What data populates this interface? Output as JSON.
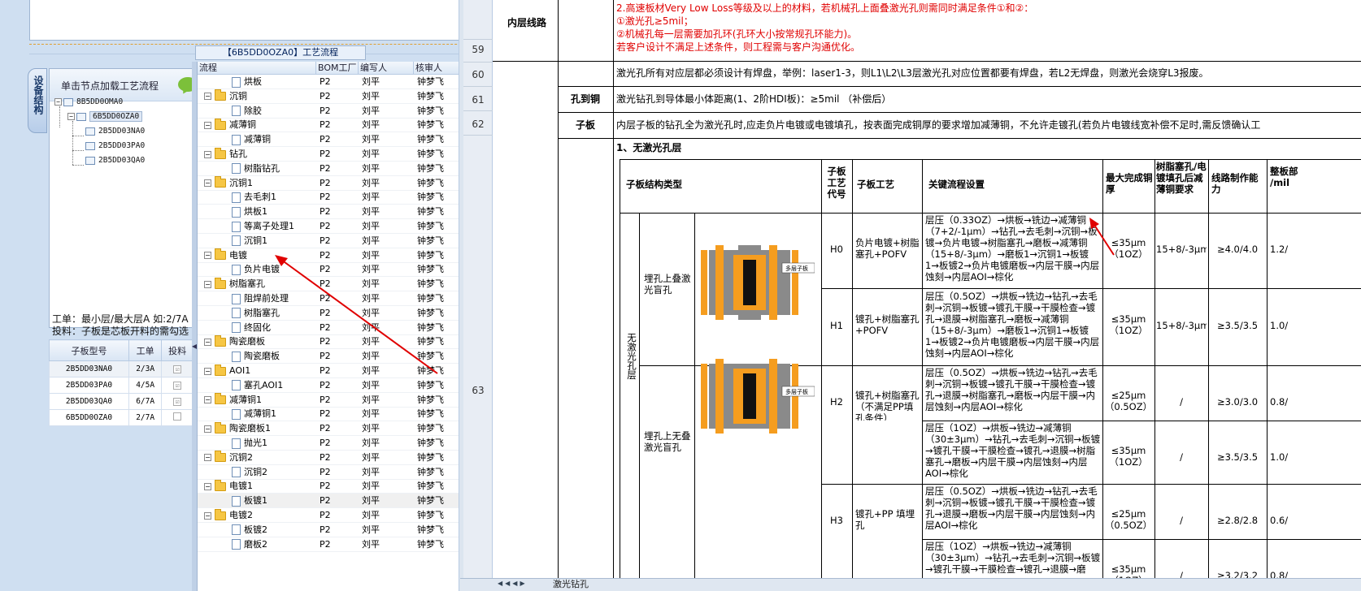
{
  "proc_title": "【6B5DD0OZA0】工艺流程",
  "tree_panel": {
    "header": "单击节点加载工艺流程",
    "side_tab": "设备结构",
    "nodes": [
      {
        "label": "8B5DD0OMA0"
      },
      {
        "label": "6B5DD0OZA0"
      },
      {
        "label": "2B5DD03NA0"
      },
      {
        "label": "2B5DD03PA0"
      },
      {
        "label": "2B5DD03QA0"
      }
    ]
  },
  "info": {
    "line1": "工单：最小层/最大层A 如:2/7A",
    "line2": "投料：子板是芯板开料的需勾选"
  },
  "sub_table": {
    "headers": [
      "子板型号",
      "工单",
      "投料"
    ],
    "rows": [
      {
        "model": "2B5DD03NA0",
        "order": "2/3A",
        "feed": "☑"
      },
      {
        "model": "2B5DD03PA0",
        "order": "4/5A",
        "feed": "☑"
      },
      {
        "model": "2B5DD03QA0",
        "order": "6/7A",
        "feed": "☑"
      },
      {
        "model": "6B5DD0OZA0",
        "order": "2/7A",
        "feed": ""
      }
    ]
  },
  "flow": {
    "headers": [
      "流程",
      "BOM工厂",
      "编写人",
      "核审人"
    ],
    "rows": [
      {
        "name": "烘板",
        "level": 2,
        "factory": "P2",
        "writer": "刘平",
        "checker": "钟梦飞"
      },
      {
        "name": "沉铜",
        "level": 1,
        "factory": "P2",
        "writer": "刘平",
        "checker": "钟梦飞"
      },
      {
        "name": "除胶",
        "level": 2,
        "factory": "P2",
        "writer": "刘平",
        "checker": "钟梦飞"
      },
      {
        "name": "减薄铜",
        "level": 1,
        "factory": "P2",
        "writer": "刘平",
        "checker": "钟梦飞"
      },
      {
        "name": "减薄铜",
        "level": 2,
        "factory": "P2",
        "writer": "刘平",
        "checker": "钟梦飞"
      },
      {
        "name": "钻孔",
        "level": 1,
        "factory": "P2",
        "writer": "刘平",
        "checker": "钟梦飞"
      },
      {
        "name": "树脂钻孔",
        "level": 2,
        "factory": "P2",
        "writer": "刘平",
        "checker": "钟梦飞"
      },
      {
        "name": "沉铜1",
        "level": 1,
        "factory": "P2",
        "writer": "刘平",
        "checker": "钟梦飞"
      },
      {
        "name": "去毛刺1",
        "level": 2,
        "factory": "P2",
        "writer": "刘平",
        "checker": "钟梦飞"
      },
      {
        "name": "烘板1",
        "level": 2,
        "factory": "P2",
        "writer": "刘平",
        "checker": "钟梦飞"
      },
      {
        "name": "等离子处理1",
        "level": 2,
        "factory": "P2",
        "writer": "刘平",
        "checker": "钟梦飞"
      },
      {
        "name": "沉铜1",
        "level": 2,
        "factory": "P2",
        "writer": "刘平",
        "checker": "钟梦飞"
      },
      {
        "name": "电镀",
        "level": 1,
        "factory": "P2",
        "writer": "刘平",
        "checker": "钟梦飞"
      },
      {
        "name": "负片电镀",
        "level": 2,
        "factory": "P2",
        "writer": "刘平",
        "checker": "钟梦飞"
      },
      {
        "name": "树脂塞孔",
        "level": 1,
        "factory": "P2",
        "writer": "刘平",
        "checker": "钟梦飞"
      },
      {
        "name": "阻焊前处理",
        "level": 2,
        "factory": "P2",
        "writer": "刘平",
        "checker": "钟梦飞"
      },
      {
        "name": "树脂塞孔",
        "level": 2,
        "factory": "P2",
        "writer": "刘平",
        "checker": "钟梦飞"
      },
      {
        "name": "终固化",
        "level": 2,
        "factory": "P2",
        "writer": "刘平",
        "checker": "钟梦飞"
      },
      {
        "name": "陶瓷磨板",
        "level": 1,
        "factory": "P2",
        "writer": "刘平",
        "checker": "钟梦飞"
      },
      {
        "name": "陶瓷磨板",
        "level": 2,
        "factory": "P2",
        "writer": "刘平",
        "checker": "钟梦飞"
      },
      {
        "name": "AOI1",
        "level": 1,
        "factory": "P2",
        "writer": "刘平",
        "checker": "钟梦飞"
      },
      {
        "name": "塞孔AOI1",
        "level": 2,
        "factory": "P2",
        "writer": "刘平",
        "checker": "钟梦飞"
      },
      {
        "name": "减薄铜1",
        "level": 1,
        "factory": "P2",
        "writer": "刘平",
        "checker": "钟梦飞"
      },
      {
        "name": "减薄铜1",
        "level": 2,
        "factory": "P2",
        "writer": "刘平",
        "checker": "钟梦飞"
      },
      {
        "name": "陶瓷磨板1",
        "level": 1,
        "factory": "P2",
        "writer": "刘平",
        "checker": "钟梦飞"
      },
      {
        "name": "抛光1",
        "level": 2,
        "factory": "P2",
        "writer": "刘平",
        "checker": "钟梦飞"
      },
      {
        "name": "沉铜2",
        "level": 1,
        "factory": "P2",
        "writer": "刘平",
        "checker": "钟梦飞"
      },
      {
        "name": "沉铜2",
        "level": 2,
        "factory": "P2",
        "writer": "刘平",
        "checker": "钟梦飞"
      },
      {
        "name": "电镀1",
        "level": 1,
        "factory": "P2",
        "writer": "刘平",
        "checker": "钟梦飞"
      },
      {
        "name": "板镀1",
        "level": 2,
        "factory": "P2",
        "writer": "刘平",
        "checker": "钟梦飞",
        "highlight": true
      },
      {
        "name": "电镀2",
        "level": 1,
        "factory": "P2",
        "writer": "刘平",
        "checker": "钟梦飞"
      },
      {
        "name": "板镀2",
        "level": 2,
        "factory": "P2",
        "writer": "刘平",
        "checker": "钟梦飞"
      },
      {
        "name": "磨板2",
        "level": 2,
        "factory": "P2",
        "writer": "刘平",
        "checker": "钟梦飞"
      }
    ]
  },
  "row_numbers": [
    "59",
    "60",
    "61",
    "62",
    "63"
  ],
  "sheet_tab": "激光钻孔",
  "doc": {
    "inner_layer_label": "内层线路",
    "red_lines": [
      "2.高速板材Very Low Loss等级及以上的材料，若机械孔上面叠激光孔则需同时满足条件①和②：",
      "①激光孔≥5mil；",
      "②机械孔每一层需要加孔环(孔环大小按常规孔环能力)。",
      "若客户设计不满足上述条件，则工程需与客户沟通优化。"
    ],
    "pad_note": "激光孔所有对应层都必须设计有焊盘，举例：laser1-3，则L1\\L2\\L3层激光孔对应位置都要有焊盘，若L2无焊盘，则激光会烧穿L3报废。",
    "hole_to_copper_label": "孔到铜",
    "hole_to_copper_text": "激光钻孔到导体最小体距离(1、2阶HDI板)：≥5mil （补偿后）",
    "sub_board_label": "子板",
    "sub_board_text": "内层子板的钻孔全为激光孔时,应走负片电镀或电镀填孔，按表面完成铜厚的要求增加减薄铜，不允许走镀孔(若负片电镀线宽补偿不足时,需反馈确认工",
    "section_title": "1、无激光孔层",
    "table_headers": [
      "子板结构类型",
      "子板工艺代号",
      "子板工艺",
      "关键流程设置",
      "最大完成铜厚",
      "树脂塞孔/电镀填孔后减薄铜要求",
      "线路制作能力",
      "整板部 /mil"
    ],
    "vertical_group": "无激光孔层",
    "struct1": "埋孔上叠激光盲孔",
    "struct2": "埋孔上无叠激光盲孔",
    "multilayer_label": "多层子板",
    "rows": [
      {
        "code": "H0",
        "proc": "负片电镀+树脂塞孔+POFV",
        "flow": "层压（0.33OZ）→烘板→铣边→减薄铜（7+2/-1μm）→钻孔→去毛刺→沉铜→板镀→负片电镀→树脂塞孔→磨板→减薄铜（15+8/-3μm）→磨板1→沉铜1→板镀1→板镀2→负片电镀磨板→内层干膜→内层蚀刻→内层AOI→棕化",
        "cu": "≤35μm（1OZ）",
        "thin": "15+8/-3μm",
        "line": "≥4.0/4.0",
        "last": "1.2/"
      },
      {
        "code": "H1",
        "proc": "镀孔+树脂塞孔+POFV",
        "flow": "层压（0.5OZ）→烘板→铣边→钻孔→去毛刺→沉铜→板镀→镀孔干膜→干膜检查→镀孔→退膜→树脂塞孔→磨板→减薄铜（15+8/-3μm）→磨板1→沉铜1→板镀1→板镀2→负片电镀磨板→内层干膜→内层蚀刻→内层AOI→棕化",
        "cu": "≤35μm（1OZ）",
        "thin": "15+8/-3μm",
        "line": "≥3.5/3.5",
        "last": "1.0/"
      },
      {
        "code": "H2",
        "proc": "镀孔+树脂塞孔（不满足PP填孔条件）",
        "flow": "层压（0.5OZ）→烘板→铣边→钻孔→去毛刺→沉铜→板镀→镀孔干膜→干膜检查→镀孔→退膜→树脂塞孔→磨板→内层干膜→内层蚀刻→内层AOI→棕化",
        "cu": "≤25μm（0.5OZ）",
        "thin": "/",
        "line": "≥3.0/3.0",
        "last": "0.8/"
      },
      {
        "code": "",
        "proc": "",
        "flow": "层压（1OZ）→烘板→铣边→减薄铜（30±3μm）→钻孔→去毛刺→沉铜→板镀→镀孔干膜→干膜检查→镀孔→退膜→树脂塞孔→磨板→内层干膜→内层蚀刻→内层AOI→棕化",
        "cu": "≤35μm（1OZ）",
        "thin": "/",
        "line": "≥3.5/3.5",
        "last": "1.0/"
      },
      {
        "code": "H3",
        "proc": "镀孔+PP 填埋孔",
        "flow": "层压（0.5OZ）→烘板→铣边→钻孔→去毛刺→沉铜→板镀→镀孔干膜→干膜检查→镀孔→退膜→磨板→内层干膜→内层蚀刻→内层AOI→棕化",
        "cu": "≤25μm（0.5OZ）",
        "thin": "/",
        "line": "≥2.8/2.8",
        "last": "0.6/"
      },
      {
        "code": "",
        "proc": "",
        "flow": "层压（1OZ）→烘板→铣边→减薄铜（30±3μm）→钻孔→去毛刺→沉铜→板镀→镀孔干膜→干膜检查→镀孔→退膜→磨",
        "cu": "≤35μm（1OZ）",
        "thin": "/",
        "line": "≥3.2/3.2",
        "last": "0.8/"
      }
    ]
  },
  "colors": {
    "accent_red": "#e00000",
    "panel_blue": "#cfdff1"
  }
}
